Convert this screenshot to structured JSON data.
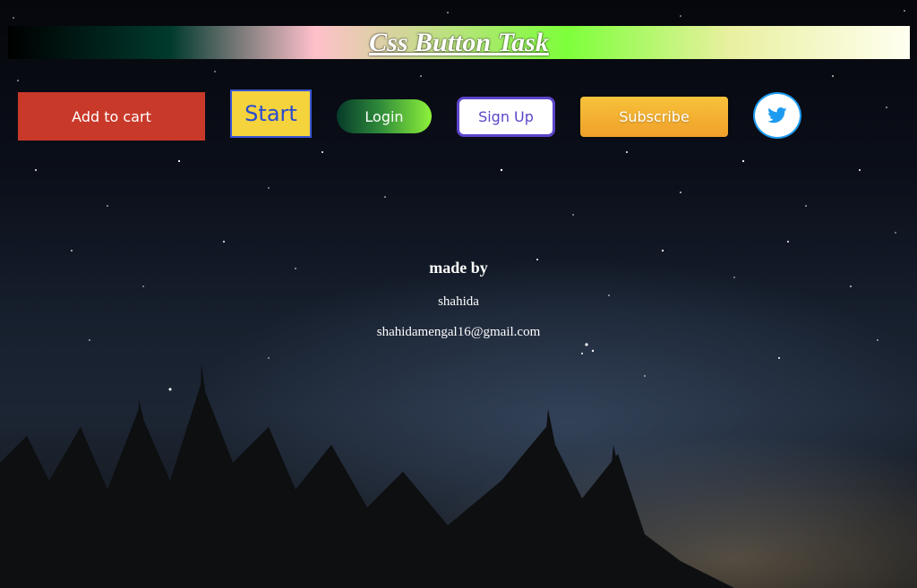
{
  "header": {
    "title": "Css Button Task"
  },
  "buttons": {
    "add_to_cart": "Add to cart",
    "start": "Start",
    "login": "Login",
    "sign_up": "Sign Up",
    "subscribe": "Subscribe",
    "twitter_icon": "twitter-icon"
  },
  "credits": {
    "made_by": "made by",
    "name": "shahida",
    "email": "shahidamengal16@gmail.com"
  },
  "colors": {
    "add_to_cart_bg": "#c9392a",
    "start_bg": "#f5d33c",
    "start_border": "#3a56d4",
    "sign_up_border": "#5b45c9",
    "subscribe_bg": "#f0a02a",
    "twitter_blue": "#1d9bf0"
  }
}
